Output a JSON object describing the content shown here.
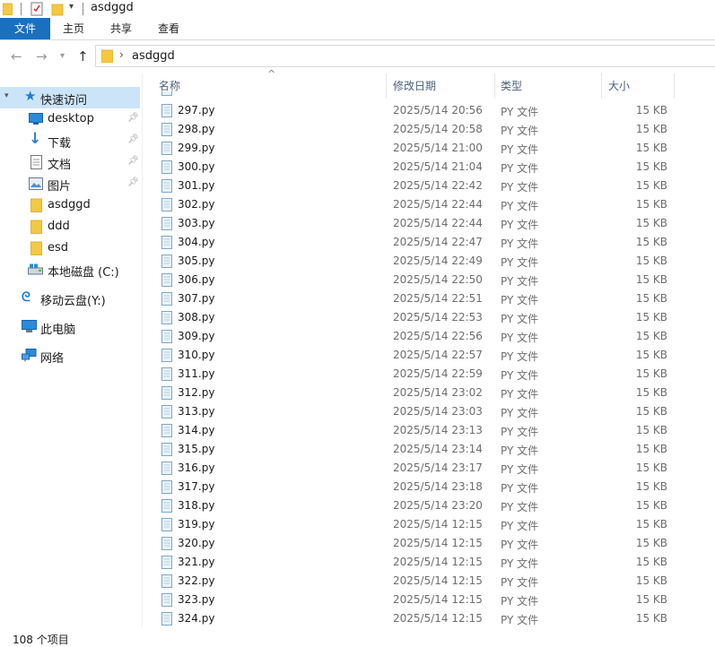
{
  "window": {
    "title": "asdggd"
  },
  "ribbon": {
    "tabs": [
      "文件",
      "主页",
      "共享",
      "查看"
    ]
  },
  "address": {
    "path": "asdggd"
  },
  "sidebar": {
    "items": [
      {
        "label": "快速访问",
        "icon": "star-icon",
        "pinned": false,
        "selected": true
      },
      {
        "label": "desktop",
        "icon": "desktop-icon",
        "pinned": true
      },
      {
        "label": "下载",
        "icon": "download-icon",
        "pinned": true
      },
      {
        "label": "文档",
        "icon": "document-icon",
        "pinned": true
      },
      {
        "label": "图片",
        "icon": "picture-icon",
        "pinned": true
      },
      {
        "label": "asdggd",
        "icon": "folder-icon",
        "pinned": false
      },
      {
        "label": "ddd",
        "icon": "folder-icon",
        "pinned": false
      },
      {
        "label": "esd",
        "icon": "folder-icon",
        "pinned": false
      },
      {
        "label": "本地磁盘 (C:)",
        "icon": "drive-icon",
        "pinned": false
      },
      {
        "label": "移动云盘(Y:)",
        "icon": "cloud-drive-icon",
        "pinned": false
      },
      {
        "label": "此电脑",
        "icon": "computer-icon",
        "pinned": false
      },
      {
        "label": "网络",
        "icon": "network-icon",
        "pinned": false
      }
    ]
  },
  "columns": {
    "name": "名称",
    "date": "修改日期",
    "type": "类型",
    "size": "大小"
  },
  "files": [
    {
      "name": "297.py",
      "date": "2025/5/14 20:56",
      "type": "PY 文件",
      "size": "15 KB"
    },
    {
      "name": "298.py",
      "date": "2025/5/14 20:58",
      "type": "PY 文件",
      "size": "15 KB"
    },
    {
      "name": "299.py",
      "date": "2025/5/14 21:00",
      "type": "PY 文件",
      "size": "15 KB"
    },
    {
      "name": "300.py",
      "date": "2025/5/14 21:04",
      "type": "PY 文件",
      "size": "15 KB"
    },
    {
      "name": "301.py",
      "date": "2025/5/14 22:42",
      "type": "PY 文件",
      "size": "15 KB"
    },
    {
      "name": "302.py",
      "date": "2025/5/14 22:44",
      "type": "PY 文件",
      "size": "15 KB"
    },
    {
      "name": "303.py",
      "date": "2025/5/14 22:44",
      "type": "PY 文件",
      "size": "15 KB"
    },
    {
      "name": "304.py",
      "date": "2025/5/14 22:47",
      "type": "PY 文件",
      "size": "15 KB"
    },
    {
      "name": "305.py",
      "date": "2025/5/14 22:49",
      "type": "PY 文件",
      "size": "15 KB"
    },
    {
      "name": "306.py",
      "date": "2025/5/14 22:50",
      "type": "PY 文件",
      "size": "15 KB"
    },
    {
      "name": "307.py",
      "date": "2025/5/14 22:51",
      "type": "PY 文件",
      "size": "15 KB"
    },
    {
      "name": "308.py",
      "date": "2025/5/14 22:53",
      "type": "PY 文件",
      "size": "15 KB"
    },
    {
      "name": "309.py",
      "date": "2025/5/14 22:56",
      "type": "PY 文件",
      "size": "15 KB"
    },
    {
      "name": "310.py",
      "date": "2025/5/14 22:57",
      "type": "PY 文件",
      "size": "15 KB"
    },
    {
      "name": "311.py",
      "date": "2025/5/14 22:59",
      "type": "PY 文件",
      "size": "15 KB"
    },
    {
      "name": "312.py",
      "date": "2025/5/14 23:02",
      "type": "PY 文件",
      "size": "15 KB"
    },
    {
      "name": "313.py",
      "date": "2025/5/14 23:03",
      "type": "PY 文件",
      "size": "15 KB"
    },
    {
      "name": "314.py",
      "date": "2025/5/14 23:13",
      "type": "PY 文件",
      "size": "15 KB"
    },
    {
      "name": "315.py",
      "date": "2025/5/14 23:14",
      "type": "PY 文件",
      "size": "15 KB"
    },
    {
      "name": "316.py",
      "date": "2025/5/14 23:17",
      "type": "PY 文件",
      "size": "15 KB"
    },
    {
      "name": "317.py",
      "date": "2025/5/14 23:18",
      "type": "PY 文件",
      "size": "15 KB"
    },
    {
      "name": "318.py",
      "date": "2025/5/14 23:20",
      "type": "PY 文件",
      "size": "15 KB"
    },
    {
      "name": "319.py",
      "date": "2025/5/14 12:15",
      "type": "PY 文件",
      "size": "15 KB"
    },
    {
      "name": "320.py",
      "date": "2025/5/14 12:15",
      "type": "PY 文件",
      "size": "15 KB"
    },
    {
      "name": "321.py",
      "date": "2025/5/14 12:15",
      "type": "PY 文件",
      "size": "15 KB"
    },
    {
      "name": "322.py",
      "date": "2025/5/14 12:15",
      "type": "PY 文件",
      "size": "15 KB"
    },
    {
      "name": "323.py",
      "date": "2025/5/14 12:15",
      "type": "PY 文件",
      "size": "15 KB"
    },
    {
      "name": "324.py",
      "date": "2025/5/14 12:15",
      "type": "PY 文件",
      "size": "15 KB"
    }
  ],
  "status": {
    "text": "108 个项目"
  },
  "colors": {
    "accent": "#1b6fbf",
    "selection": "#cce4f7",
    "folder": "#f5c842",
    "header_text": "#4c607a"
  }
}
